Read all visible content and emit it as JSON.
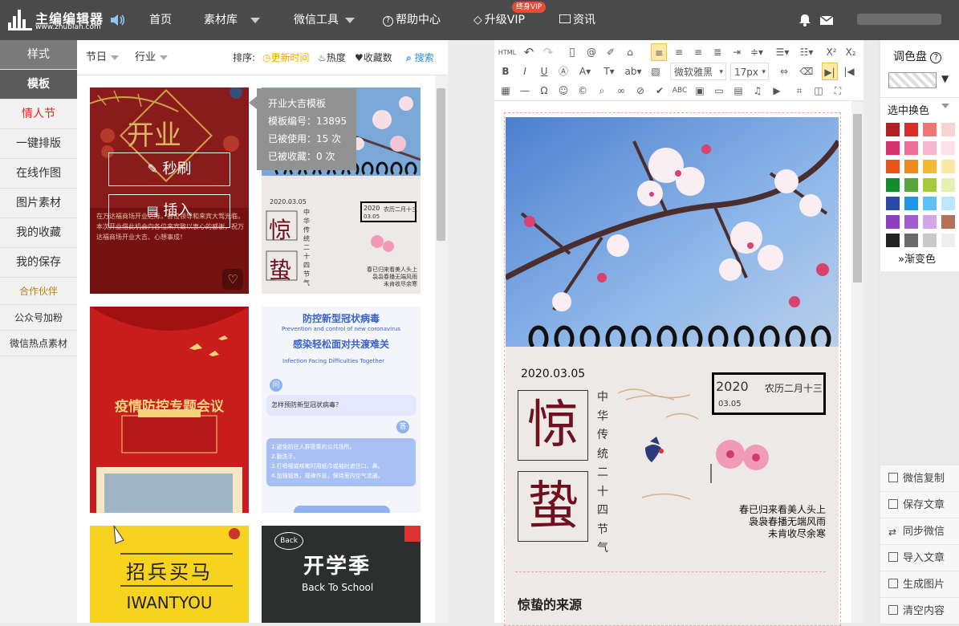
{
  "app": {
    "logo_cn": "主编编辑器",
    "logo_url": "www.zhubian.com"
  },
  "topnav": {
    "items": [
      "首页",
      "素材库",
      "微信工具",
      "帮助中心",
      "升级VIP",
      "资讯"
    ],
    "vip_badge": "终身VIP"
  },
  "sidebar": {
    "items": [
      "样式",
      "模板",
      "情人节",
      "一键排版",
      "在线作图",
      "图片素材",
      "我的收藏",
      "我的保存",
      "合作伙伴",
      "公众号加粉",
      "微信热点素材"
    ]
  },
  "filter": {
    "festival": "节日",
    "industry": "行业",
    "sort_label": "排序:",
    "sort_time": "更新时间",
    "sort_hot": "热度",
    "sort_fav": "收藏数",
    "search": "搜索"
  },
  "tooltip": {
    "title": "开业大吉模板",
    "line1": "模板编号：13895",
    "line2": "已被使用：15 次",
    "line3": "已被收藏：0 次"
  },
  "card_overlay": {
    "quick": "秒刷",
    "insert": "插入"
  },
  "templates": {
    "t1_title": "开业",
    "t1_body": "在万达福商场开业之际，各位领导和来宾大驾光临，本次开业借此机会向各位来宾致以衷心的感谢，祝万达福商场开业大吉、心想事成！",
    "t2_date": "2020.03.05",
    "t2_year": "2020",
    "t2_lunar": "农历二月十三",
    "t2_md": "03.05",
    "t2_big1": "惊",
    "t2_big2": "蛰",
    "t2_vertical": "中华传统二十四节气",
    "t2_poem1": "春已归来看美人头上",
    "t2_poem2": "袅袅春播无端风雨",
    "t2_poem3": "未肯收尽余寒",
    "t3_title": "疫情防控专题会议",
    "t4_title1": "防控新型冠状病毒",
    "t4_en1": "Prevention and control of new coronavirus",
    "t4_title2": "感染轻松面对共渡难关",
    "t4_en2": "Infection Facing Difficulties Together",
    "t4_q": "问",
    "t4_question": "怎样预防新型冠状病毒？",
    "t4_a": "答",
    "t4_answer1": "1.避免前往人群密集的公共场所。",
    "t4_answer2": "2.勤洗手。",
    "t4_answer3": "3.打喷嚏或咳嗽时用纸巾或袖肘遮住口、鼻。",
    "t4_answer4": "4.加强锻炼，规律作息，保持室内空气流通。",
    "t5_title": "招兵买马",
    "t5_en": "IWANTYOU",
    "t6_title": "开学季",
    "t6_en": "Back To School",
    "t6_bubble": "Back"
  },
  "toolbar": {
    "html": "HTML",
    "font_name": "微软雅黑",
    "font_size": "17px"
  },
  "editor": {
    "date": "2020.03.05",
    "year": "2020",
    "lunar": "农历二月十三",
    "md": "03.05",
    "big1": "惊",
    "big2": "蛰",
    "vertical": [
      "中",
      "华",
      "传",
      "统",
      "二",
      "十",
      "四",
      "节",
      "气"
    ],
    "poem1": "春已归来看美人头上",
    "poem2": "袅袅春播无端风雨",
    "poem3": "未肯收尽余寒",
    "heading": "惊蛰的来源"
  },
  "palette": {
    "title": "调色盘",
    "select_label": "选中换色",
    "gradient": "渐变色",
    "colors": [
      "#b22222",
      "#dc2b2b",
      "#f07575",
      "#f9d2d2",
      "#d6336c",
      "#ee6f9c",
      "#f5b8cf",
      "#fbe1ea",
      "#e8561a",
      "#f08a1c",
      "#f5b833",
      "#fbe6a1",
      "#168a2e",
      "#5aa53a",
      "#a6c83b",
      "#e7f0b2",
      "#2b4aa8",
      "#2196e8",
      "#5cc2f5",
      "#bfe6fb",
      "#8e3fbf",
      "#a45dcf",
      "#d3a6e6",
      "#b5705a",
      "#222222",
      "#6b6b6b",
      "#c9c9c9",
      "#eeeeee"
    ]
  },
  "actions": {
    "items": [
      "微信复制",
      "保存文章",
      "同步微信",
      "导入文章",
      "生成图片",
      "清空内容"
    ]
  }
}
